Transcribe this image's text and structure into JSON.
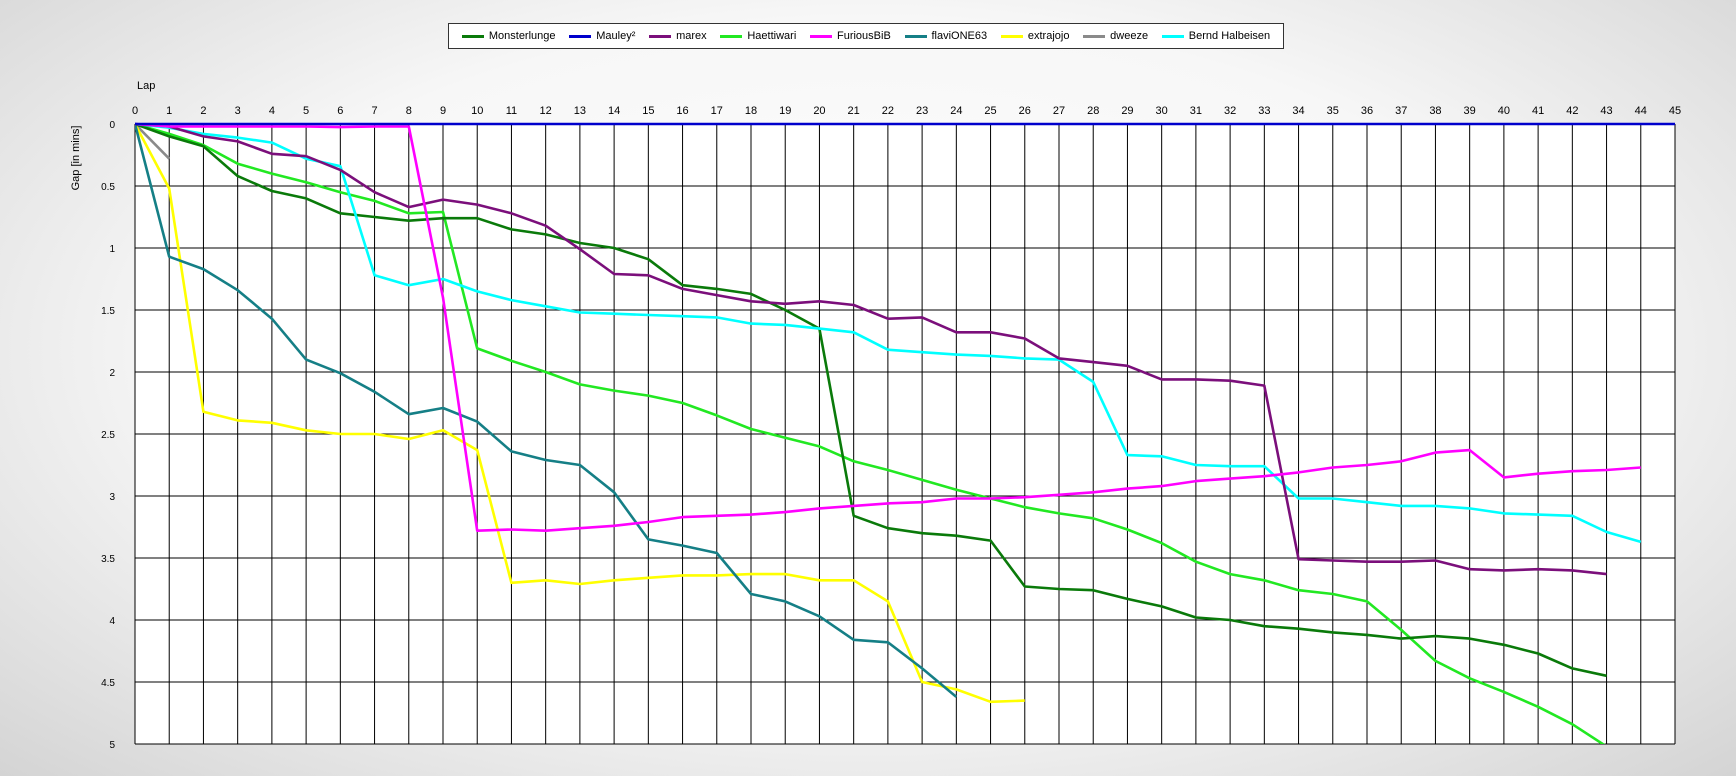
{
  "chart_data": {
    "type": "line",
    "xlabel": "Lap",
    "ylabel": "Gap [in mins]",
    "xlim": [
      0,
      45
    ],
    "ylim": [
      0,
      5
    ],
    "y_inverted": true,
    "grid": true,
    "legend_position": "top-center",
    "x_ticks": [
      0,
      1,
      2,
      3,
      4,
      5,
      6,
      7,
      8,
      9,
      10,
      11,
      12,
      13,
      14,
      15,
      16,
      17,
      18,
      19,
      20,
      21,
      22,
      23,
      24,
      25,
      26,
      27,
      28,
      29,
      30,
      31,
      32,
      33,
      34,
      35,
      36,
      37,
      38,
      39,
      40,
      41,
      42,
      43,
      44,
      45
    ],
    "y_ticks": [
      {
        "value": 0,
        "label": "0"
      },
      {
        "value": 0.5,
        "label": "0.5"
      },
      {
        "value": 1,
        "label": "1"
      },
      {
        "value": 1.5,
        "label": "1.5"
      },
      {
        "value": 2,
        "label": "2"
      },
      {
        "value": 2.5,
        "label": "2.5"
      },
      {
        "value": 3,
        "label": "3"
      },
      {
        "value": 3.5,
        "label": "3.5"
      },
      {
        "value": 4,
        "label": "4"
      },
      {
        "value": 4.5,
        "label": "4.5"
      },
      {
        "value": 5,
        "label": "5"
      }
    ],
    "series": [
      {
        "name": "Mauley²",
        "color": "#0000cc",
        "key": "mauley",
        "x": [
          0,
          45
        ],
        "y": [
          0,
          0
        ]
      },
      {
        "name": "Monsterlunge",
        "color": "#0a7a0a",
        "key": "monsterlunge",
        "x": [
          0,
          1,
          2,
          3,
          4,
          5,
          6,
          7,
          8,
          9,
          10,
          11,
          12,
          13,
          14,
          15,
          16,
          17,
          18,
          19,
          20,
          21,
          22,
          23,
          24,
          25,
          26,
          27,
          28,
          29,
          30,
          31,
          32,
          33,
          34,
          35,
          36,
          37,
          38,
          39,
          40,
          41,
          42,
          43
        ],
        "y": [
          0,
          0.1,
          0.18,
          0.42,
          0.54,
          0.6,
          0.72,
          0.75,
          0.78,
          0.76,
          0.76,
          0.85,
          0.89,
          0.96,
          1.0,
          1.09,
          1.3,
          1.33,
          1.37,
          1.5,
          1.65,
          3.16,
          3.26,
          3.3,
          3.32,
          3.36,
          3.73,
          3.75,
          3.76,
          3.83,
          3.89,
          3.98,
          4.0,
          4.05,
          4.07,
          4.1,
          4.12,
          4.15,
          4.13,
          4.15,
          4.2,
          4.27,
          4.39,
          4.45
        ]
      },
      {
        "name": "marex",
        "color": "#7b0f7b",
        "key": "marex",
        "x": [
          0,
          1,
          2,
          3,
          4,
          5,
          6,
          7,
          8,
          9,
          10,
          11,
          12,
          13,
          14,
          15,
          16,
          17,
          18,
          19,
          20,
          21,
          22,
          23,
          24,
          25,
          26,
          27,
          28,
          29,
          30,
          31,
          32,
          33,
          34,
          35,
          36,
          37,
          38,
          39,
          40,
          41,
          42,
          43
        ],
        "y": [
          0,
          0.02,
          0.1,
          0.14,
          0.24,
          0.26,
          0.37,
          0.55,
          0.67,
          0.61,
          0.65,
          0.72,
          0.82,
          1.01,
          1.21,
          1.22,
          1.33,
          1.38,
          1.43,
          1.45,
          1.43,
          1.46,
          1.57,
          1.56,
          1.68,
          1.68,
          1.73,
          1.89,
          1.92,
          1.95,
          2.06,
          2.06,
          2.07,
          2.11,
          3.51,
          3.52,
          3.53,
          3.53,
          3.52,
          3.59,
          3.6,
          3.59,
          3.6,
          3.63
        ]
      },
      {
        "name": "Haettiwari",
        "color": "#22e822",
        "key": "haettiwari",
        "x": [
          0,
          1,
          2,
          3,
          4,
          5,
          6,
          7,
          8,
          9,
          10,
          11,
          12,
          13,
          14,
          15,
          16,
          17,
          18,
          19,
          20,
          21,
          22,
          23,
          24,
          25,
          26,
          27,
          28,
          29,
          30,
          31,
          32,
          33,
          34,
          35,
          36,
          37,
          38,
          39,
          40,
          41,
          42,
          43
        ],
        "y": [
          0,
          0.08,
          0.17,
          0.32,
          0.4,
          0.47,
          0.55,
          0.62,
          0.72,
          0.71,
          1.81,
          1.91,
          2.0,
          2.1,
          2.15,
          2.19,
          2.25,
          2.35,
          2.46,
          2.53,
          2.6,
          2.72,
          2.79,
          2.87,
          2.95,
          3.02,
          3.09,
          3.14,
          3.18,
          3.27,
          3.38,
          3.53,
          3.63,
          3.68,
          3.76,
          3.79,
          3.85,
          4.08,
          4.33,
          4.47,
          4.58,
          4.7,
          4.84,
          5.02
        ]
      },
      {
        "name": "FuriousBiB",
        "color": "#ff00ff",
        "key": "furiousbib",
        "x": [
          0,
          1,
          2,
          3,
          4,
          5,
          6,
          7,
          8,
          9,
          10,
          11,
          12,
          13,
          14,
          15,
          16,
          17,
          18,
          19,
          20,
          21,
          22,
          23,
          24,
          25,
          26,
          27,
          28,
          29,
          30,
          31,
          32,
          33,
          34,
          35,
          36,
          37,
          38,
          39,
          40,
          41,
          42,
          43,
          44
        ],
        "y": [
          0,
          0.02,
          0.02,
          0.02,
          0.02,
          0.02,
          0.025,
          0.02,
          0.02,
          1.4,
          3.28,
          3.27,
          3.28,
          3.26,
          3.24,
          3.21,
          3.17,
          3.16,
          3.15,
          3.13,
          3.1,
          3.08,
          3.06,
          3.05,
          3.02,
          3.02,
          3.01,
          2.99,
          2.97,
          2.94,
          2.92,
          2.88,
          2.86,
          2.84,
          2.81,
          2.77,
          2.75,
          2.72,
          2.65,
          2.63,
          2.85,
          2.82,
          2.8,
          2.79,
          2.77
        ]
      },
      {
        "name": "flaviONE63",
        "color": "#157f86",
        "key": "flavione63",
        "x": [
          0,
          1,
          2,
          3,
          4,
          5,
          6,
          7,
          8,
          9,
          10,
          11,
          12,
          13,
          14,
          15,
          16,
          17,
          18,
          19,
          20,
          21,
          22,
          23,
          24
        ],
        "y": [
          0,
          1.07,
          1.17,
          1.34,
          1.57,
          1.9,
          2.01,
          2.16,
          2.34,
          2.29,
          2.4,
          2.64,
          2.71,
          2.75,
          2.97,
          3.35,
          3.4,
          3.46,
          3.79,
          3.85,
          3.97,
          4.16,
          4.18,
          4.39,
          4.62
        ]
      },
      {
        "name": "extrajojo",
        "color": "#ffff00",
        "key": "extrajojo",
        "x": [
          0,
          1,
          2,
          3,
          4,
          5,
          6,
          7,
          8,
          9,
          10,
          11,
          12,
          13,
          14,
          15,
          16,
          17,
          18,
          19,
          20,
          21,
          22,
          23,
          24,
          25,
          26
        ],
        "y": [
          0,
          0.52,
          2.32,
          2.39,
          2.41,
          2.47,
          2.5,
          2.5,
          2.54,
          2.47,
          2.63,
          3.7,
          3.68,
          3.71,
          3.68,
          3.66,
          3.64,
          3.64,
          3.63,
          3.63,
          3.68,
          3.68,
          3.85,
          4.5,
          4.56,
          4.66,
          4.65
        ]
      },
      {
        "name": "dweeze",
        "color": "#8a8a8a",
        "key": "dweeze",
        "x": [
          0,
          1
        ],
        "y": [
          0,
          0.28
        ]
      },
      {
        "name": "Bernd Halbeisen",
        "color": "#00ffff",
        "key": "bernd",
        "x": [
          0,
          1,
          2,
          3,
          4,
          5,
          6,
          7,
          8,
          9,
          10,
          11,
          12,
          13,
          14,
          15,
          16,
          17,
          18,
          19,
          20,
          21,
          22,
          23,
          24,
          25,
          26,
          27,
          28,
          29,
          30,
          31,
          32,
          33,
          34,
          35,
          36,
          37,
          38,
          39,
          40,
          41,
          42,
          43,
          44
        ],
        "y": [
          0,
          0.03,
          0.08,
          0.11,
          0.15,
          0.28,
          0.34,
          1.22,
          1.3,
          1.25,
          1.35,
          1.42,
          1.47,
          1.52,
          1.53,
          1.54,
          1.55,
          1.56,
          1.61,
          1.62,
          1.65,
          1.68,
          1.82,
          1.84,
          1.86,
          1.87,
          1.89,
          1.9,
          2.08,
          2.67,
          2.68,
          2.75,
          2.76,
          2.76,
          3.02,
          3.02,
          3.05,
          3.08,
          3.08,
          3.1,
          3.14,
          3.15,
          3.16,
          3.29,
          3.37
        ]
      }
    ]
  },
  "legend_order": [
    "monsterlunge",
    "mauley",
    "marex",
    "haettiwari",
    "furiousbib",
    "flavione63",
    "extrajojo",
    "dweeze",
    "bernd"
  ]
}
